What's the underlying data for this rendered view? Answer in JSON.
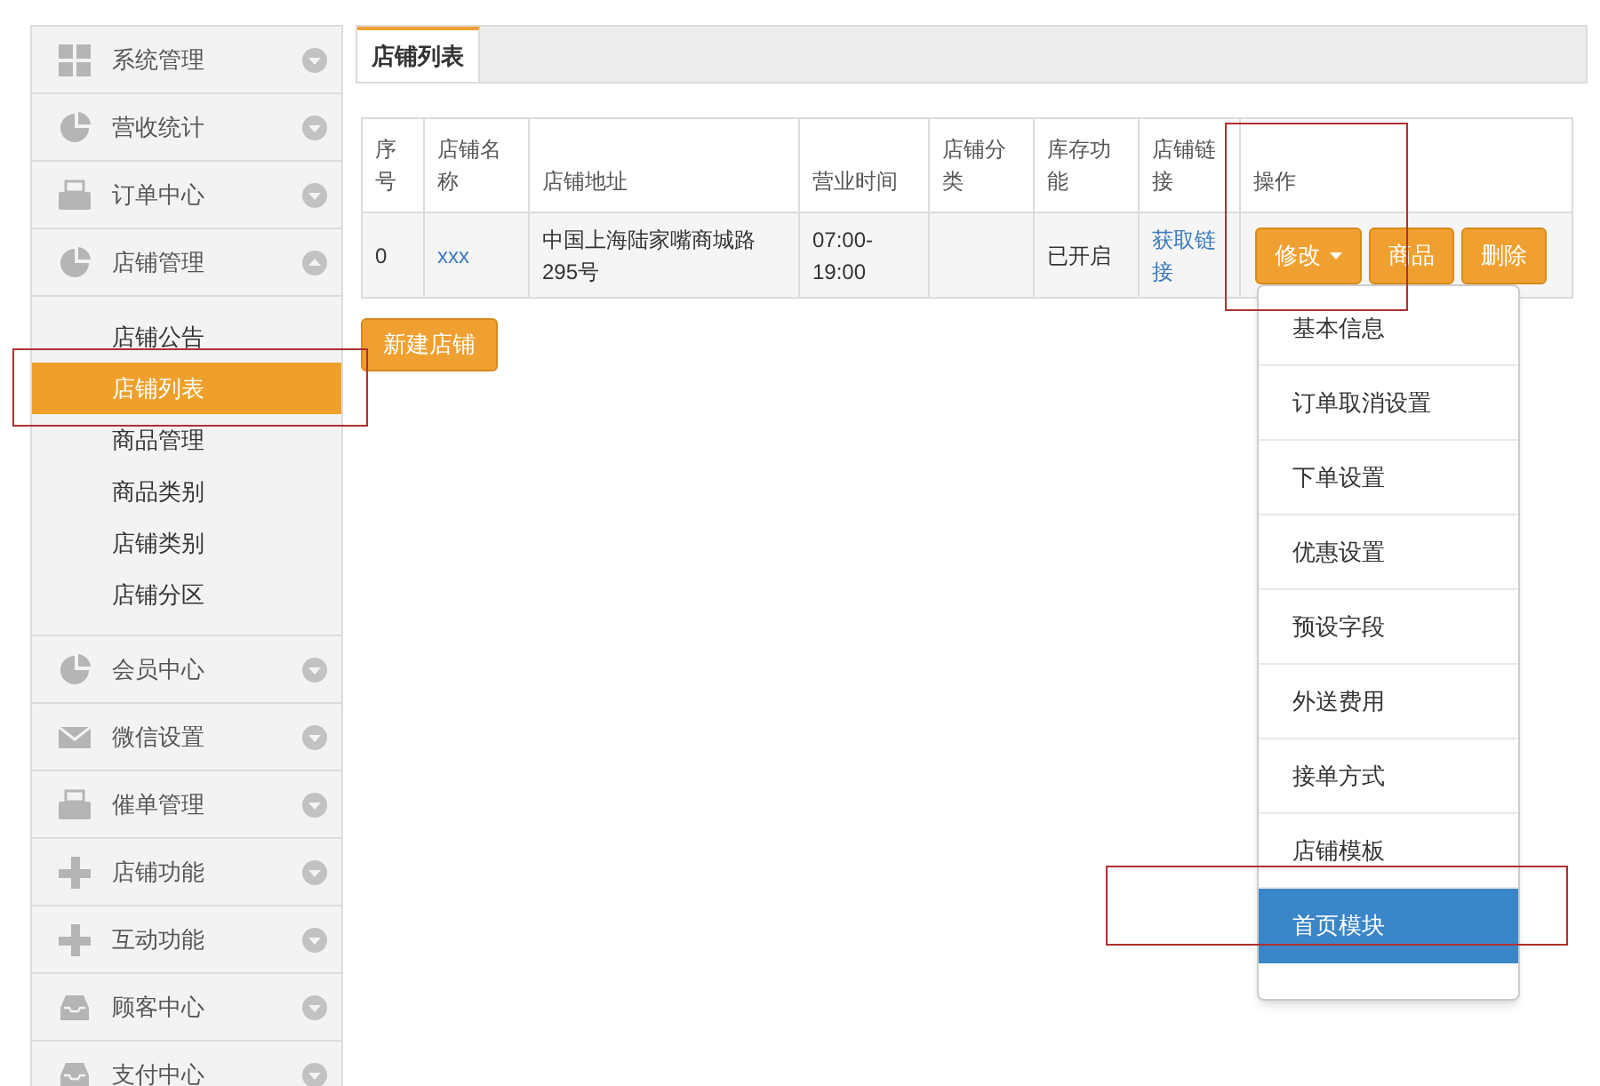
{
  "sidebar": {
    "items": [
      {
        "label": "系统管理",
        "expanded": false
      },
      {
        "label": "营收统计",
        "expanded": false
      },
      {
        "label": "订单中心",
        "expanded": false
      },
      {
        "label": "店铺管理",
        "expanded": true,
        "children": [
          {
            "label": "店铺公告",
            "selected": false
          },
          {
            "label": "店铺列表",
            "selected": true
          },
          {
            "label": "商品管理",
            "selected": false
          },
          {
            "label": "商品类别",
            "selected": false
          },
          {
            "label": "店铺类别",
            "selected": false
          },
          {
            "label": "店铺分区",
            "selected": false
          }
        ]
      },
      {
        "label": "会员中心",
        "expanded": false
      },
      {
        "label": "微信设置",
        "expanded": false
      },
      {
        "label": "催单管理",
        "expanded": false
      },
      {
        "label": "店铺功能",
        "expanded": false
      },
      {
        "label": "互动功能",
        "expanded": false
      },
      {
        "label": "顾客中心",
        "expanded": false
      },
      {
        "label": "支付中心",
        "expanded": false
      }
    ]
  },
  "tabs": [
    {
      "label": "店铺列表",
      "selected": true
    }
  ],
  "table": {
    "columns": [
      "序号",
      "店铺名称",
      "店铺地址",
      "营业时间",
      "店铺分类",
      "库存功能",
      "店铺链接",
      "操作"
    ],
    "rows": [
      {
        "cells": [
          "0",
          "xxx",
          "中国上海陆家嘴商城路295号",
          "07:00-19:00",
          "",
          "已开启",
          "获取链接"
        ],
        "actions": [
          "修改",
          "商品",
          "删除"
        ]
      }
    ]
  },
  "new_button": "新建店铺",
  "dropdown": {
    "items": [
      {
        "label": "基本信息",
        "selected": false
      },
      {
        "label": "订单取消设置",
        "selected": false
      },
      {
        "label": "下单设置",
        "selected": false
      },
      {
        "label": "优惠设置",
        "selected": false
      },
      {
        "label": "预设字段",
        "selected": false
      },
      {
        "label": "外送费用",
        "selected": false
      },
      {
        "label": "接单方式",
        "selected": false
      },
      {
        "label": "店铺模板",
        "selected": false
      },
      {
        "label": "首页模块",
        "selected": true
      }
    ]
  }
}
